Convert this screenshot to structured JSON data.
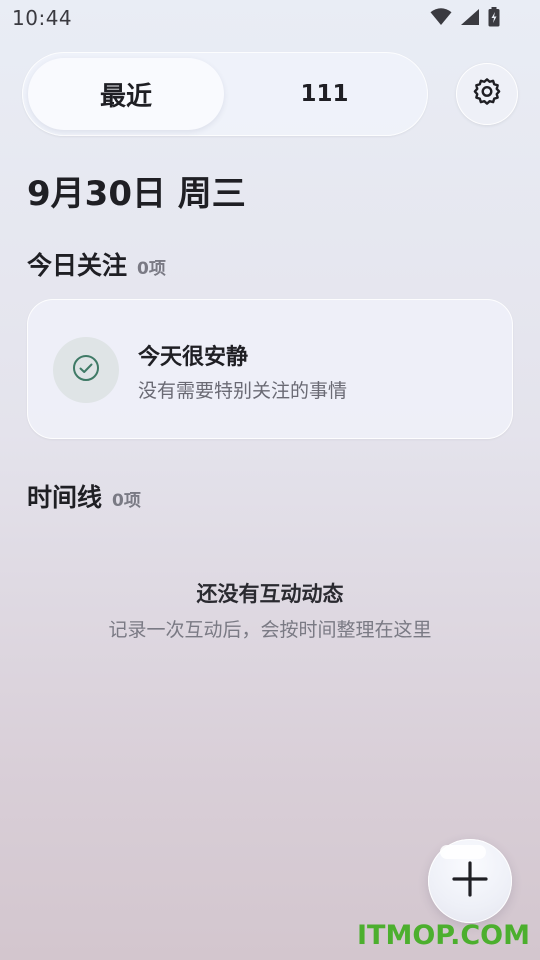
{
  "status_bar": {
    "time": "10:44",
    "icons": [
      "wifi-icon",
      "cellular-signal-icon",
      "battery-charging-icon"
    ]
  },
  "tabs": {
    "recent_label": "最近",
    "other_label": "111",
    "selected": "最近"
  },
  "settings": {
    "icon": "gear-icon"
  },
  "date_heading": "9月30日 周三",
  "focus_section": {
    "title": "今日关注",
    "count": "0项",
    "card": {
      "icon": "check-circle-icon",
      "title": "今天很安静",
      "subtitle": "没有需要特别关注的事情"
    }
  },
  "timeline_section": {
    "title": "时间线",
    "count": "0项",
    "empty_title": "还没有互动动态",
    "empty_subtitle": "记录一次互动后，会按时间整理在这里"
  },
  "fab": {
    "icon": "plus-icon"
  },
  "watermark": "ITMOP.COM",
  "colors": {
    "accent_check": "#3f7a66",
    "watermark": "#4caf2e",
    "text_primary": "#1f1f24",
    "text_secondary": "#6a6a74"
  }
}
